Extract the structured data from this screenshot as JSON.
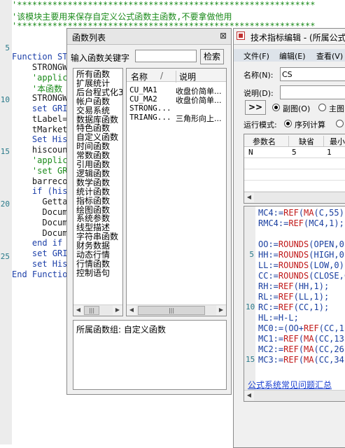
{
  "code_editor": {
    "line_numbers": [
      "5",
      "10",
      "15",
      "20",
      "25"
    ],
    "lines": [
      {
        "text": "'***********************************************************",
        "color": "green"
      },
      {
        "text": "'该模块主要用来保存自定义公式函数主函数,不要拿做他用",
        "color": "green"
      },
      {
        "text": "'***********************************************************",
        "color": "green"
      },
      {
        "text": "",
        "color": "dark"
      },
      {
        "text": "",
        "color": "dark"
      },
      {
        "text": "Function ST",
        "color": "blue"
      },
      {
        "text": "    STRONGW",
        "color": "dark"
      },
      {
        "text": "    'applic",
        "color": "green"
      },
      {
        "text": "    '本函数",
        "color": "green"
      },
      {
        "text": "    STRONGW",
        "color": "dark"
      },
      {
        "text": "    set GRI",
        "color": "blue"
      },
      {
        "text": "    tLabel=",
        "color": "dark"
      },
      {
        "text": "    tMarket",
        "color": "dark"
      },
      {
        "text": "    Set His",
        "color": "blue"
      },
      {
        "text": "    hiscoun",
        "color": "dark"
      },
      {
        "text": "    'applic",
        "color": "green"
      },
      {
        "text": "    'set GR",
        "color": "green"
      },
      {
        "text": "    barreco",
        "color": "dark"
      },
      {
        "text": "    if (his",
        "color": "blue"
      },
      {
        "text": "      Getta",
        "color": "dark"
      },
      {
        "text": "      Docum",
        "color": "dark"
      },
      {
        "text": "      Docum",
        "color": "dark"
      },
      {
        "text": "      Docum",
        "color": "dark"
      },
      {
        "text": "    end if",
        "color": "blue"
      },
      {
        "text": "    set GRI",
        "color": "blue"
      },
      {
        "text": "    set His",
        "color": "blue"
      },
      {
        "text": "End Functio",
        "color": "blue"
      }
    ]
  },
  "func_list": {
    "title": "函数列表",
    "close_glyph": "⊠",
    "search_label": "输入函数关键字",
    "search_value": "",
    "search_button": "检索",
    "categories": [
      "所有函数",
      "扩展统计",
      "后台程式化3",
      "帐户函数",
      "交易系统",
      "数据库函数",
      "特色函数",
      "自定义函数",
      "时间函数",
      "常数函数",
      "引用函数",
      "逻辑函数",
      "数学函数",
      "统计函数",
      "指标函数",
      "绘图函数",
      "系统参数",
      "线型描述",
      "字符串函数",
      "财务数据",
      "动态行情",
      "行情函数",
      "控制语句"
    ],
    "columns": {
      "name": "名称",
      "sep": "/",
      "desc": "说明"
    },
    "functions": [
      {
        "name": "CU_MA1",
        "desc": "收盘价简单..."
      },
      {
        "name": "CU_MA2",
        "desc": "收盘价简单..."
      },
      {
        "name": "STRONG...",
        "desc": ""
      },
      {
        "name": "TRIANG...",
        "desc": "三角形向上..."
      }
    ],
    "group_info": "所属函数组: 自定义函数"
  },
  "indicator_editor": {
    "title": "技术指标编辑 - (所属公式",
    "menu": [
      "文件(F)",
      "编辑(E)",
      "查看(V)"
    ],
    "name_label": "名称(N):",
    "name_value": "CS",
    "desc_label": "说明(D):",
    "desc_value": "",
    "expand_button": ">>",
    "chart_options": [
      {
        "label": "副图(O)",
        "checked": true
      },
      {
        "label": "主图",
        "checked": false
      }
    ],
    "run_mode_label": "运行模式:",
    "run_mode_option": {
      "label": "序列计算",
      "checked": true
    },
    "param_columns": [
      "参数名",
      "缺省",
      "最小"
    ],
    "param_rows": [
      {
        "name": "N",
        "default": "5",
        "min": "1"
      }
    ],
    "formula_lines": [
      "MC4:=REF(MA(C,55),",
      "RMC4:=REF(MC4,1);",
      "",
      "OO:=ROUNDS(OPEN,0)",
      "HH:=ROUNDS(HIGH,0)",
      "LL:=ROUNDS(LOW,0);",
      "CC:=ROUNDS(CLOSE,C",
      "RH:=REF(HH,1);",
      "RL:=REF(LL,1);",
      "RC:=REF(CC,1);",
      "HL:=H-L;",
      "MC0:=(OO+REF(CC,1)",
      "MC1:=REF(MA(CC,13)",
      "MC2:=REF(MA(CC,26)",
      "MC3:=REF(MA(CC,34)"
    ],
    "formula_line_numbers": [
      "5",
      "10",
      "15"
    ],
    "help_link": "公式系统常见问题汇总"
  },
  "colors": {
    "code_green": "#1a8a1a",
    "code_blue": "#1c3fa8",
    "keyword_red": "#c01818",
    "link_blue": "#1a3fd0",
    "window_bg": "#f0f0f0"
  }
}
